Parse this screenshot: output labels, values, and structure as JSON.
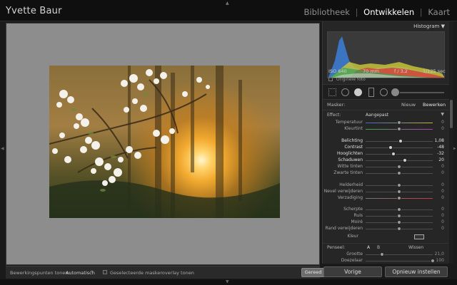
{
  "app": {
    "identity": "Yvette Baur",
    "modules": [
      "Bibliotheek",
      "Ontwikkelen",
      "Kaart"
    ],
    "active_module": "Ontwikkelen",
    "separator": "|"
  },
  "toolbar": {
    "points_label": "Bewerkingspunten tonen:",
    "points_value": "Automatisch",
    "overlay_label": "Geselecteerde maskeroverlay tonen",
    "done_label": "Gereed"
  },
  "histogram": {
    "title": "Histogram",
    "iso": "ISO 640",
    "focal": "70 mm",
    "aperture": "f / 3,2",
    "shutter": "1/125 sec",
    "original_label": "Originele foto"
  },
  "mask": {
    "label": "Masker:",
    "new_label": "Nieuw",
    "edit_label": "Bewerken"
  },
  "effect": {
    "label": "Effect:",
    "value": "Aangepast",
    "sliders": [
      {
        "name": "Temperatuur",
        "value": "0",
        "level": 0.5,
        "active": false,
        "track": "temp"
      },
      {
        "name": "Kleurtint",
        "value": "0",
        "level": 0.5,
        "active": false,
        "track": "tint"
      },
      {
        "name": "Belichting",
        "value": "1,08",
        "level": 0.52,
        "active": true,
        "track": "plain"
      },
      {
        "name": "Contrast",
        "value": "-48",
        "level": 0.37,
        "active": true,
        "track": "plain"
      },
      {
        "name": "Hooglichten",
        "value": "-32",
        "level": 0.42,
        "active": true,
        "track": "plain"
      },
      {
        "name": "Schaduwen",
        "value": "20",
        "level": 0.58,
        "active": true,
        "track": "plain"
      },
      {
        "name": "Witte tinten",
        "value": "0",
        "level": 0.5,
        "active": false,
        "track": "plain"
      },
      {
        "name": "Zwarte tinten",
        "value": "0",
        "level": 0.5,
        "active": false,
        "track": "plain"
      },
      {
        "name": "Helderheid",
        "value": "0",
        "level": 0.5,
        "active": false,
        "track": "plain"
      },
      {
        "name": "Nevel verwijderen",
        "value": "0",
        "level": 0.5,
        "active": false,
        "track": "plain"
      },
      {
        "name": "Verzadiging",
        "value": "0",
        "level": 0.5,
        "active": false,
        "track": "sat"
      },
      {
        "name": "Scherpte",
        "value": "0",
        "level": 0.5,
        "active": false,
        "track": "plain"
      },
      {
        "name": "Ruis",
        "value": "0",
        "level": 0.5,
        "active": false,
        "track": "plain"
      },
      {
        "name": "Moiré",
        "value": "0",
        "level": 0.5,
        "active": false,
        "track": "plain"
      },
      {
        "name": "Rand verwijderen",
        "value": "0",
        "level": 0.5,
        "active": false,
        "track": "plain"
      }
    ],
    "color_label": "Kleur"
  },
  "brush": {
    "label": "Penseel:",
    "a": "A",
    "b": "B",
    "wissen": "Wissen",
    "size_label": "Grootte",
    "size_value": "21,0",
    "size_level": 0.24,
    "fade_label": "Doezelaar",
    "fade_value": "100",
    "fade_level": 1.0
  },
  "buttons": {
    "previous": "Vorige",
    "reset": "Opnieuw instellen"
  }
}
